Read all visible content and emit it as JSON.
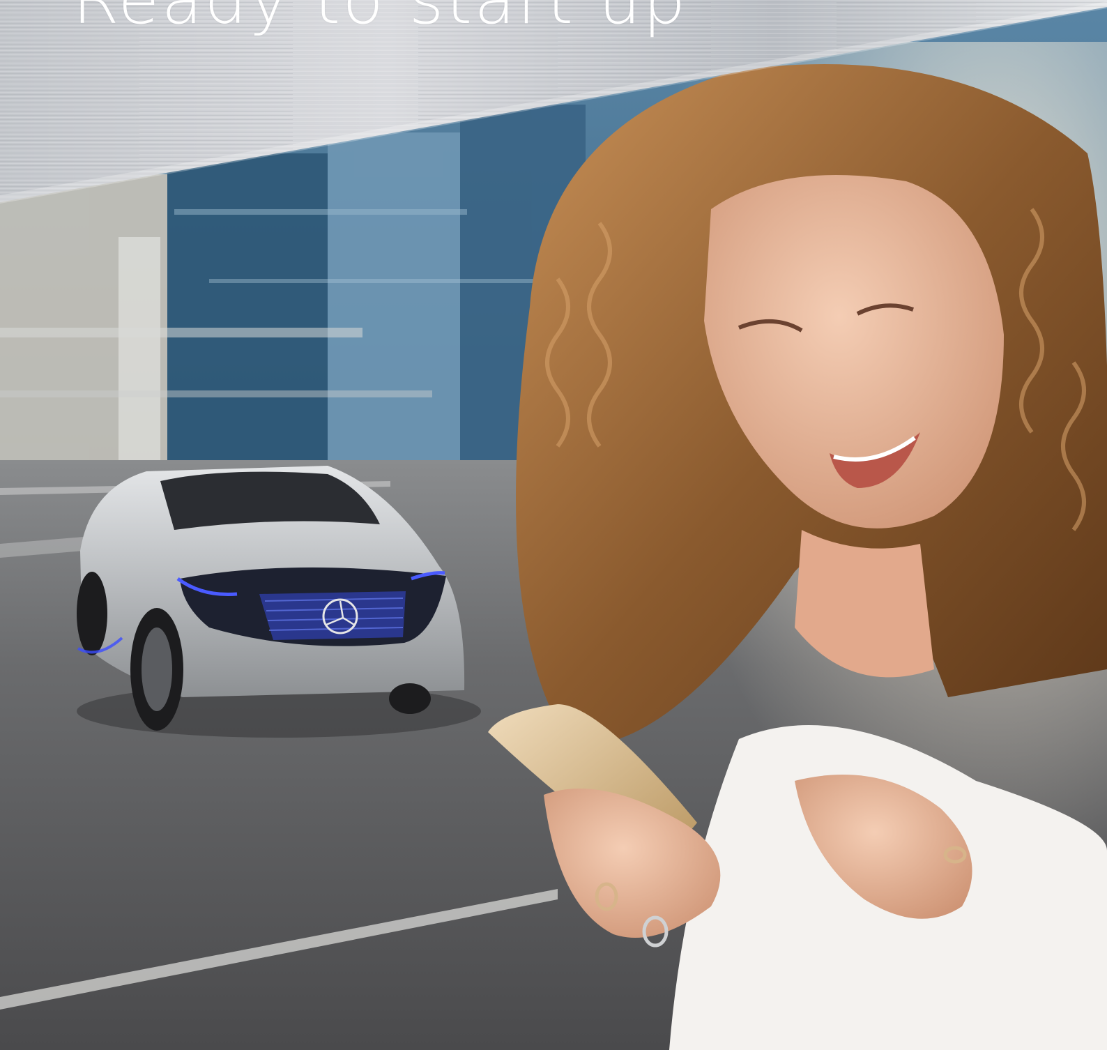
{
  "header": {
    "title": "Ready to start up"
  },
  "scene": {
    "background_panel": "brushed-metal",
    "subjects": [
      "electric-suv-car",
      "smiling-woman-with-smartphone"
    ],
    "colors": {
      "metal_light": "#d9dade",
      "metal_mid": "#b8bcc2",
      "building_blue": "#3f6a8a",
      "road_gray": "#5d5d5f",
      "car_silver": "#c9cbcd",
      "car_accent_blue": "#3b4cff",
      "hair_brown": "#8a5a2e",
      "skin": "#e9b79c",
      "phone_gold": "#d8b98e",
      "top_white": "#f4f2ef"
    }
  }
}
